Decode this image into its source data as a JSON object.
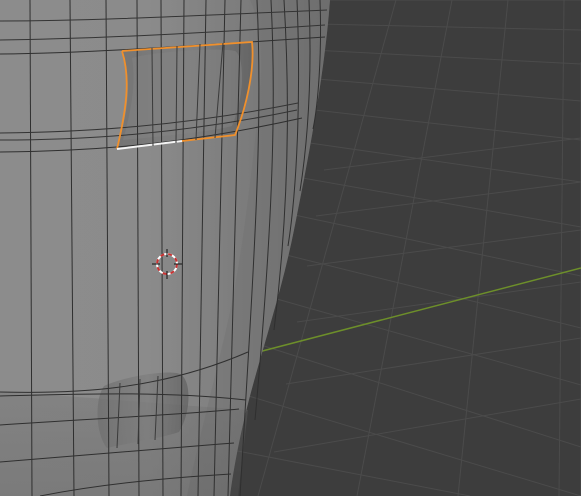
{
  "viewport": {
    "mode": "edit-mode",
    "background_color": "#3d3d3d",
    "grid_color": "#4a4a4a",
    "x_axis_color": "#6f8f2a",
    "mesh_base_color": "#8f8f8f",
    "wire_color": "#2a2a2a",
    "selection_face_color": "#f0902c",
    "selection_edge_color": "#ffffff",
    "cursor_color": "#c83232",
    "icons": {
      "cursor": "3d-cursor-icon",
      "axis": "x-axis-line",
      "grid": "floor-grid"
    }
  }
}
